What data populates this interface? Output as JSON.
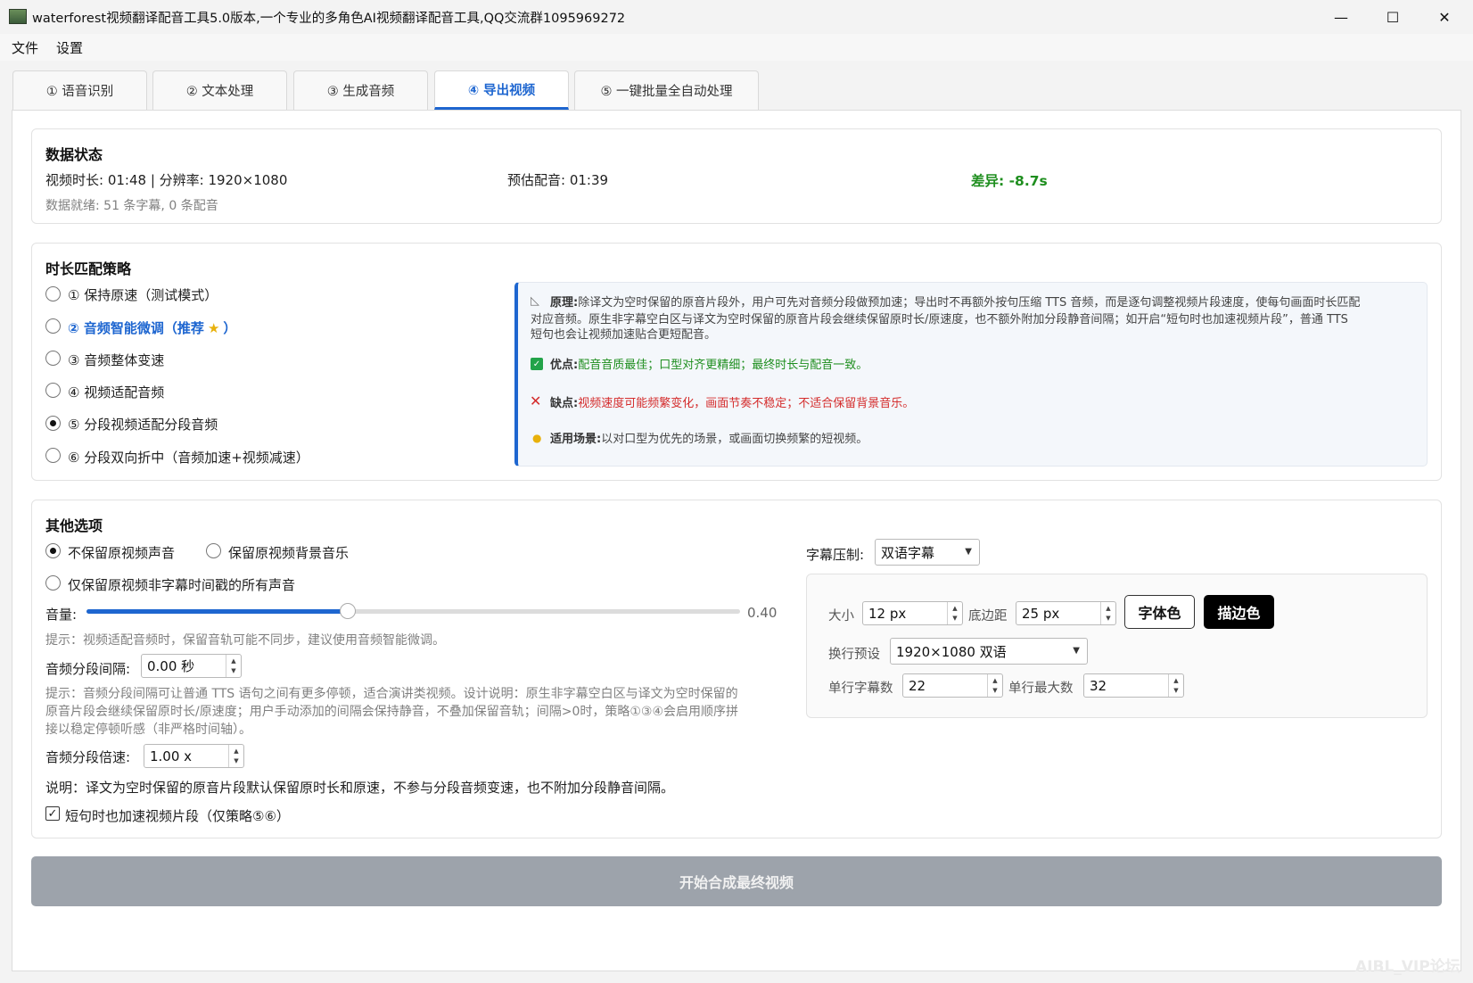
{
  "window": {
    "title": "waterforest视频翻译配音工具5.0版本,一个专业的多角色AI视频翻译配音工具,QQ交流群1095969272",
    "min": "—",
    "max": "☐",
    "close": "✕"
  },
  "menu": [
    "文件",
    "设置"
  ],
  "tabs": [
    "① 语音识别",
    "② 文本处理",
    "③ 生成音频",
    "④ 导出视频",
    "⑤ 一键批量全自动处理"
  ],
  "data_status": {
    "title": "数据状态",
    "video_info": "视频时长: 01:48 | 分辨率: 1920×1080",
    "est_dub": "预估配音: 01:39",
    "diff": "差异: -8.7s",
    "ready": "数据就绪: 51 条字幕, 0 条配音"
  },
  "strategy": {
    "title": "时长匹配策略",
    "options": [
      "① 保持原速（测试模式）",
      "② 音频智能微调（推荐",
      "③ 音频整体变速",
      "④ 视频适配音频",
      "⑤ 分段视频适配分段音频",
      "⑥ 分段双向折中（音频加速+视频减速）"
    ],
    "recommend_tail": "）",
    "selected": 4,
    "info": {
      "principle_label": "原理:",
      "principle_l1": "除译文为空时保留的原音片段外，用户可先对音频分段做预加速；导出时不再额外按句压缩 TTS 音频，而是逐句调整视频片段速度，使每句画面时长匹配",
      "principle_l2": "对应音频。原生非字幕空白区与译文为空时保留的原音片段会继续保留原时长/原速度，也不额外附加分段静音间隔；如开启“短句时也加速视频片段”，普通 TTS",
      "principle_l3": "短句也会让视频加速贴合更短配音。",
      "pros_label": "优点:",
      "pros": "配音音质最佳；口型对齐更精细；最终时长与配音一致。",
      "cons_label": "缺点:",
      "cons": "视频速度可能频繁变化，画面节奏不稳定；不适合保留背景音乐。",
      "scene_label": "适用场景:",
      "scene": "以对口型为优先的场景，或画面切换频繁的短视频。"
    }
  },
  "other": {
    "title": "其他选项",
    "audio_opts": [
      "不保留原视频声音",
      "保留原视频背景音乐",
      "仅保留原视频非字幕时间戳的所有声音"
    ],
    "audio_selected": 0,
    "volume_label": "音量:",
    "volume_value": "0.40",
    "volume": 0.4,
    "hint1": "提示：视频适配音频时，保留音轨可能不同步，建议使用音频智能微调。",
    "gap_label": "音频分段间隔:",
    "gap_value": "0.00 秒",
    "hint2_l1": "提示：音频分段间隔可让普通 TTS 语句之间有更多停顿，适合演讲类视频。设计说明：原生非字幕空白区与译文为空时保留的",
    "hint2_l2": "原音片段会继续保留原时长/原速度；用户手动添加的间隔会保持静音，不叠加保留音轨；间隔>0时，策略①③④会启用顺序拼",
    "hint2_l3": "接以稳定停顿听感（非严格时间轴）。",
    "speed_label": "音频分段倍速:",
    "speed_value": "1.00 x",
    "note": "说明：译文为空时保留的原音片段默认保留原时长和原速，不参与分段音频变速，也不附加分段静音间隔。",
    "short_accel": "短句时也加速视频片段（仅策略⑤⑥）",
    "short_accel_checked": true,
    "check_mark": "✓"
  },
  "subtitle": {
    "burn_label": "字幕压制:",
    "burn_value": "双语字幕",
    "size_label": "大小",
    "size_value": "12 px",
    "margin_label": "底边距",
    "margin_value": "25 px",
    "font_color_btn": "字体色",
    "outline_btn": "描边色",
    "preset_label": "换行预设",
    "preset_value": "1920×1080 双语",
    "line_chars_label": "单行字幕数",
    "line_chars_value": "22",
    "max_label": "单行最大数",
    "max_value": "32"
  },
  "start_button": "开始合成最终视频",
  "watermark": "AIBL_VIP论坛",
  "colors": {
    "accent": "#1e66d0",
    "ok": "#1e8e1e",
    "bad": "#d42c2c",
    "start_bg": "#9da3ab"
  }
}
